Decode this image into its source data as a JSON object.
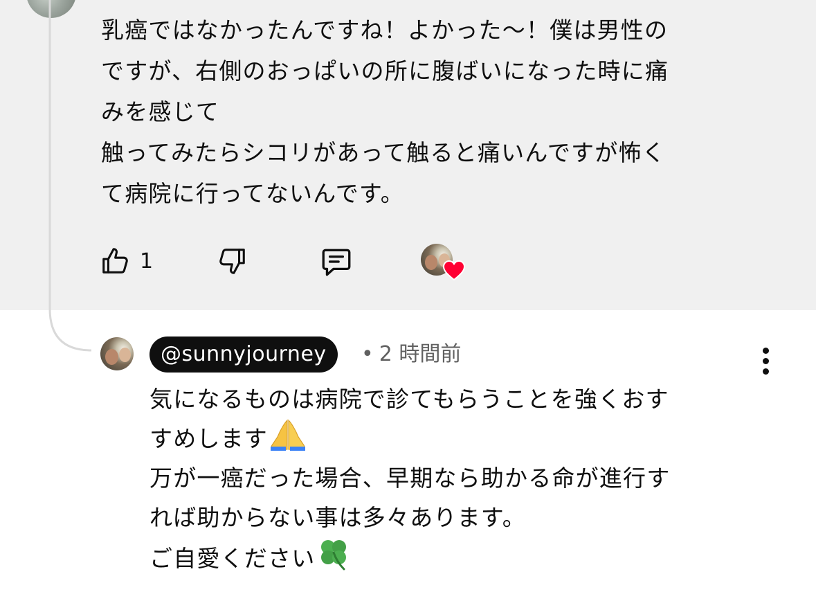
{
  "parent_comment": {
    "text_lines": [
      "乳癌ではなかったんですね！よかった〜！僕は男性の",
      "ですが、右側のおっぱいの所に腹ばいになった時に痛",
      "みを感じて",
      "触ってみたらシコリがあって触ると痛いんですが怖く",
      "て病院に行ってないんです。"
    ],
    "like_count": "1",
    "hearted": true
  },
  "reply": {
    "author": "@sunnyjourney",
    "separator": "•",
    "time": "2 時間前",
    "text_lines": [
      "気になるものは病院で診てもらうことを強くおす",
      "すめします",
      "万が一癌だった場合、早期なら助かる命が進行す",
      "れば助からない事は多々あります。",
      "ご自愛ください"
    ],
    "emojis": [
      "folded-hands",
      "four-leaf-clover"
    ]
  },
  "icons": {
    "like": "thumbs-up-icon",
    "dislike": "thumbs-down-icon",
    "reply": "comment-icon",
    "more": "more-vertical-icon",
    "heart": "heart-icon"
  },
  "colors": {
    "highlight_bg": "#f0f0f0",
    "text": "#0f0f0f",
    "meta": "#606060",
    "heart": "#ff0033",
    "author_chip_bg": "#0f0f0f",
    "author_chip_text": "#ffffff",
    "thread_line": "#d9d9d9"
  }
}
